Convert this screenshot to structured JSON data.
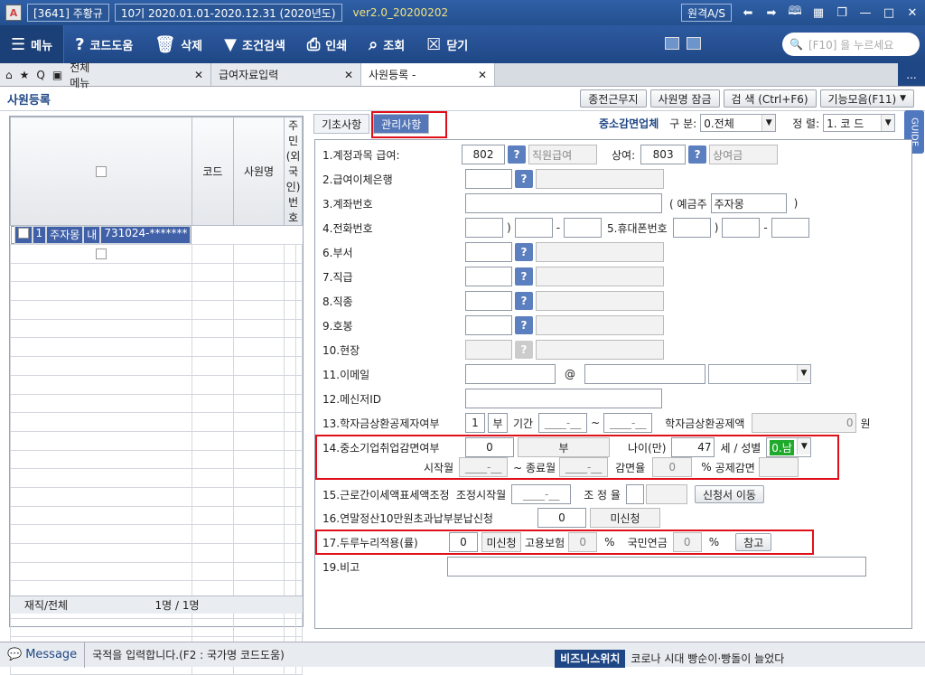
{
  "titlebar": {
    "logo": "A",
    "company": "[3641] 주황규",
    "period": "10기  2020.01.01-2020.12.31  (2020년도)",
    "version": "ver2.0_20200202",
    "remote": "원격A/S"
  },
  "toolbar": {
    "menu": "메뉴",
    "code_help": "코드도움",
    "delete": "삭제",
    "filter": "조건검색",
    "print": "인쇄",
    "lookup": "조회",
    "close": "닫기",
    "search_placeholder": "[F10] 을 누르세요"
  },
  "tabs": {
    "home_menu": "전체메뉴",
    "items": [
      {
        "label": "급여자료입력"
      },
      {
        "label": "사원등록 -"
      }
    ],
    "more": "..."
  },
  "page": {
    "title": "사원등록",
    "buttons": [
      "종전근무지",
      "사원명 잠금",
      "검  색 (Ctrl+F6)",
      "기능모음(F11)"
    ]
  },
  "grid": {
    "headers": [
      "코드",
      "사원명",
      "주민(외국인)번호"
    ],
    "rows": [
      {
        "code": "1",
        "name": "주자몽",
        "type": "내",
        "id": "731024-*******"
      }
    ],
    "footer_label": "재직/전체",
    "footer_value": "1명 / 1명"
  },
  "subtabs": [
    "기초사항",
    "관리사항"
  ],
  "right_header": {
    "company_type": "중소감면업체",
    "gubun_label": "구 분:",
    "gubun_value": "0.전체",
    "sort_label": "정 렬:",
    "sort_value": "1. 코  드"
  },
  "guide": "GUIDE",
  "form": {
    "r1": {
      "label": "1.계정과목 급여:",
      "code": "802",
      "name": "직원급여",
      "bonus_label": "상여:",
      "bonus_code": "803",
      "bonus_name": "상여금"
    },
    "r2": {
      "label": "2.급여이체은행"
    },
    "r3": {
      "label": "3.계좌번호",
      "holder_label": "( 예금주",
      "holder": "주자몽",
      "close": ")"
    },
    "r4": {
      "label": "4.전화번호",
      "p1": ")",
      "p2": "-",
      "mobile_label": "5.휴대폰번호",
      "p3": ")",
      "p4": "-"
    },
    "r6": {
      "label": "6.부서"
    },
    "r7": {
      "label": "7.직급"
    },
    "r8": {
      "label": "8.직종"
    },
    "r9": {
      "label": "9.호봉"
    },
    "r10": {
      "label": "10.현장"
    },
    "r11": {
      "label": "11.이메일",
      "at": "@"
    },
    "r12": {
      "label": "12.메신저ID"
    },
    "r13": {
      "label": "13.학자금상환공제자여부",
      "val": "1",
      "val_text": "부",
      "period_label": "기간",
      "from": "____-__",
      "tilde": "~",
      "to": "____-__",
      "amt_label": "학자금상환공제액",
      "amt": "0",
      "unit": "원"
    },
    "r14": {
      "label": "14.중소기업취업감면여부",
      "val": "0",
      "val_text": "부",
      "age_label": "나이(만)",
      "age": "47",
      "gender_label": "세 / 성별",
      "gender": "0.남",
      "start_label": "시작월",
      "start": "____-__",
      "end_label": "~ 종료월",
      "end": "____-__",
      "rate_label": "감면율",
      "rate": "0",
      "pct": "%",
      "deduct_label": "공제감면"
    },
    "r15": {
      "label": "15.근로간이세액표세액조정",
      "adj_start_label": "조정시작월",
      "adj_start": "____-__",
      "adj_rate_label": "조 정 율",
      "apply_button": "신청서 이동"
    },
    "r16": {
      "label": "16.연말정산10만원초과납부분납신청",
      "val": "0",
      "val_text": "미신청"
    },
    "r17": {
      "label": "17.두루누리적용(률)",
      "val": "0",
      "val_text": "미신청",
      "emp_label": "고용보험",
      "emp": "0",
      "pct1": "%",
      "pen_label": "국민연금",
      "pen": "0",
      "pct2": "%",
      "ref_button": "참고"
    },
    "r19": {
      "label": "19.비고"
    }
  },
  "status": {
    "message_label": "Message",
    "message": "국적을 입력합니다.(F2 : 국가명 코드도움)",
    "biz_label": "비즈니스위치",
    "news": "코로나 시대 빵순이·빵돌이 늘었다"
  },
  "colors": {
    "primary": "#1f4785",
    "highlight": "#e0101a",
    "selected_row": "#4060a8"
  }
}
